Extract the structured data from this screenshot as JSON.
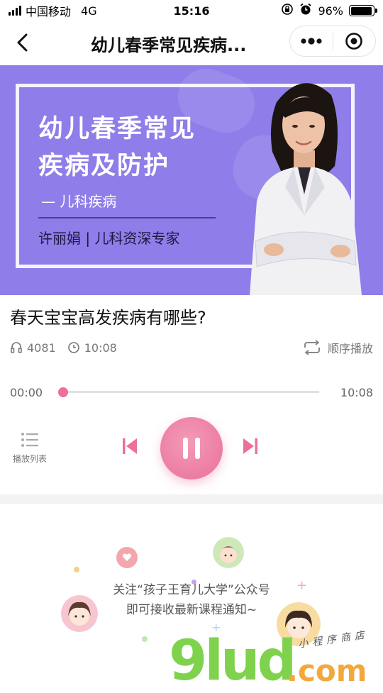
{
  "status_bar": {
    "carrier": "中国移动",
    "network": "4G",
    "time": "15:16",
    "battery": "96%",
    "battery_level": 0.96
  },
  "nav": {
    "title": "幼儿春季常见疾病..."
  },
  "banner": {
    "title_line1": "幼儿春季常见",
    "title_line2": "疾病及防护",
    "subtitle": "— 儿科疾病",
    "speaker": "许丽娟 | 儿科资深专家",
    "bg_color": "#8f7de9"
  },
  "lesson": {
    "title": "春天宝宝高发疾病有哪些?",
    "plays": "4081",
    "duration": "10:08",
    "mode": "顺序播放"
  },
  "player": {
    "current": "00:00",
    "total": "10:08",
    "progress": 0.0,
    "playlist_label": "播放列表",
    "accent": "#ec7097"
  },
  "promo": {
    "line1": "关注“孩子王育儿大学”公众号",
    "line2": "即可接收最新课程通知~"
  },
  "watermark": {
    "main": "9lud",
    "suffix": ".com",
    "tag": "小程序商店"
  }
}
